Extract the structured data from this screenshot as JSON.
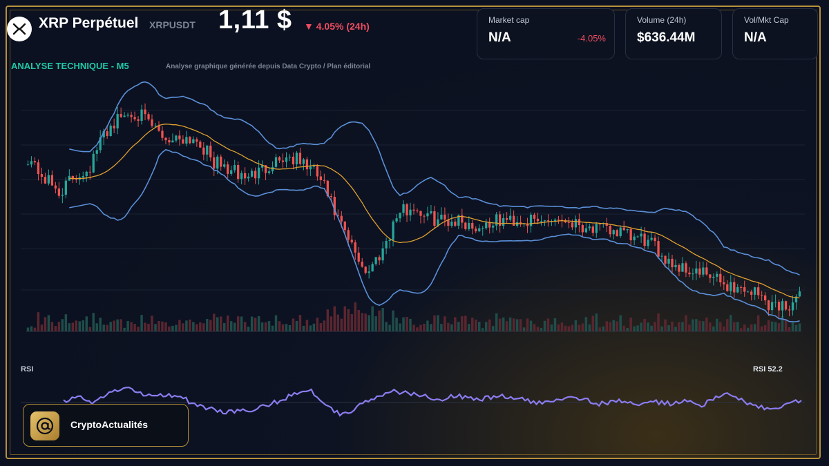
{
  "header": {
    "asset_name": "XRP Perpétuel",
    "asset_symbol": "XRPUSDT",
    "price": "1,11 $",
    "change": "▼ 4.05% (24h)",
    "subtitle": "ANALYSE TECHNIQUE - M5",
    "note": "Analyse graphique générée depuis Data Crypto / Plan éditorial"
  },
  "cards": [
    {
      "label": "Market cap",
      "value": "N/A",
      "change": "-4.05%"
    },
    {
      "label": "Volume (24h)",
      "value": "$636.44M",
      "change": ""
    },
    {
      "label": "Vol/Mkt Cap",
      "value": "N/A",
      "change": ""
    }
  ],
  "brand": {
    "name": "CryptoActualités"
  },
  "rsi": {
    "label": "RSI",
    "value_label": "RSI 52.2"
  },
  "colors": {
    "up": "#26a69a",
    "down": "#ef5350",
    "bollinger": "#5b8fd8",
    "ma": "#e0a030",
    "rsi": "#8b7cf0",
    "accent": "#21c7a8",
    "gold": "#b8913a"
  },
  "icons": {
    "logo": "xrp-logo-icon",
    "brand": "at-sign-icon"
  },
  "chart_data": [
    {
      "type": "candlestick",
      "title": "ANALYSE TECHNIQUE - M5",
      "indicators": [
        "bollinger-bands",
        "moving-average",
        "volume"
      ],
      "grid": true,
      "close_trend": [
        1.174,
        1.166,
        1.16,
        1.166,
        1.17,
        1.184,
        1.19,
        1.192,
        1.186,
        1.181,
        1.182,
        1.181,
        1.172,
        1.169,
        1.166,
        1.168,
        1.173,
        1.174,
        1.171,
        1.165,
        1.15,
        1.138,
        1.128,
        1.138,
        1.152,
        1.154,
        1.15,
        1.149,
        1.149,
        1.146,
        1.148,
        1.149,
        1.149,
        1.148,
        1.15,
        1.149,
        1.147,
        1.145,
        1.145,
        1.142,
        1.141,
        1.136,
        1.131,
        1.129,
        1.127,
        1.124,
        1.122,
        1.121,
        1.116,
        1.115,
        1.118
      ]
    },
    {
      "type": "line",
      "title": "RSI",
      "series": [
        {
          "name": "RSI",
          "values": [
            52,
            54,
            51,
            56,
            60,
            58,
            55,
            56,
            55,
            50,
            47,
            45,
            46,
            45,
            49,
            52,
            57,
            59,
            51,
            44,
            46,
            52,
            55,
            58,
            56,
            55,
            53,
            55,
            54,
            53,
            55,
            54,
            52,
            50,
            53,
            55,
            53,
            50,
            51,
            52,
            49,
            51,
            50,
            52,
            49,
            53,
            56,
            52,
            48,
            46,
            50,
            52
          ]
        }
      ]
    }
  ]
}
